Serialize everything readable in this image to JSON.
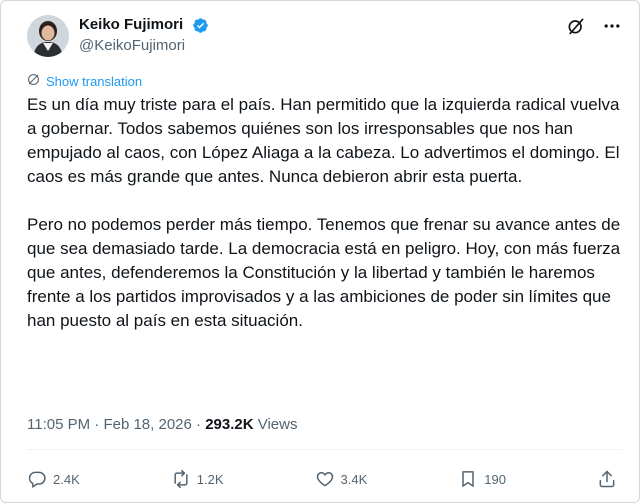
{
  "author": {
    "display_name": "Keiko Fujimori",
    "handle": "@KeikoFujimori",
    "verified": true
  },
  "translate_link": "Show translation",
  "post": {
    "paragraphs": [
      "Es un día muy triste para el país. Han permitido que la izquierda radical vuelva a gobernar. Todos sabemos quiénes son los irresponsables que nos han empujado al caos, con López Aliaga a la cabeza. Lo advertimos el domingo. El caos es más grande que antes. Nunca debieron abrir esta puerta.",
      "Pero no podemos perder más tiempo. Tenemos que frenar su avance antes de que sea demasiado tarde. La democracia está en peligro. Hoy, con más fuerza que antes, defenderemos la Constitución y la libertad y también le haremos frente a los partidos improvisados y a las ambiciones de poder sin límites que han puesto al país en esta situación."
    ]
  },
  "meta": {
    "time": "11:05 PM",
    "separator": "·",
    "date": "Feb 18, 2026",
    "views_count": "293.2K",
    "views_label": "Views"
  },
  "actions": {
    "replies": "2.4K",
    "reposts": "1.2K",
    "likes": "3.4K",
    "bookmarks": "190"
  },
  "colors": {
    "accent": "#1d9bf0",
    "text": "#0f1419",
    "muted": "#536471",
    "border": "#cfd9de"
  },
  "icons": [
    "verified-badge-icon",
    "grok-icon",
    "more-icon",
    "translate-icon",
    "reply-icon",
    "repost-icon",
    "like-icon",
    "bookmark-icon",
    "share-icon"
  ]
}
